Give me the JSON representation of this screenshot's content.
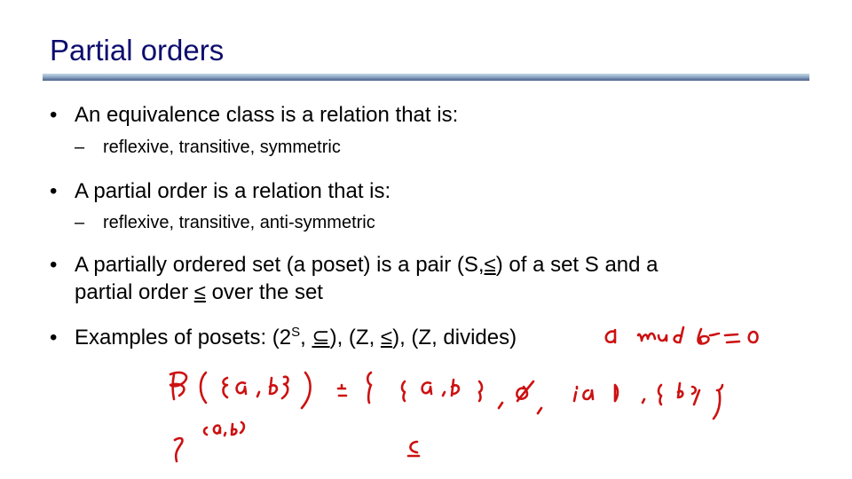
{
  "slide": {
    "title": "Partial orders",
    "bullets": [
      {
        "marker": "•",
        "text": "An equivalence class is a relation that is:",
        "sub": {
          "marker": "–",
          "text": "reflexive, transitive, symmetric"
        }
      },
      {
        "marker": "•",
        "text": "A partial order is a relation that is:",
        "sub": {
          "marker": "–",
          "text": "reflexive, transitive, anti-symmetric"
        }
      },
      {
        "marker": "•",
        "line1_a": "A partially ordered set (a poset) is a pair (S,",
        "leq": "≤",
        "line1_b": ") of a set S and a",
        "line2_a": "partial order ",
        "line2_b": " over the set"
      },
      {
        "marker": "•",
        "part_a": "Examples of posets: (2",
        "sup": "S",
        "part_b": ", ",
        "subseteq": "⊆",
        "part_c": "), (Z, ",
        "part_d": "), (Z, divides)"
      }
    ]
  },
  "annotations": {
    "color": "#cc1111",
    "mod_note": "a mod b = 0",
    "powerset_line": "P({a,b}) = {{a,b}, ∅, {a}, {b}}",
    "powerset_alt": "2^{a,b}",
    "subset_symbol": "⊆"
  }
}
